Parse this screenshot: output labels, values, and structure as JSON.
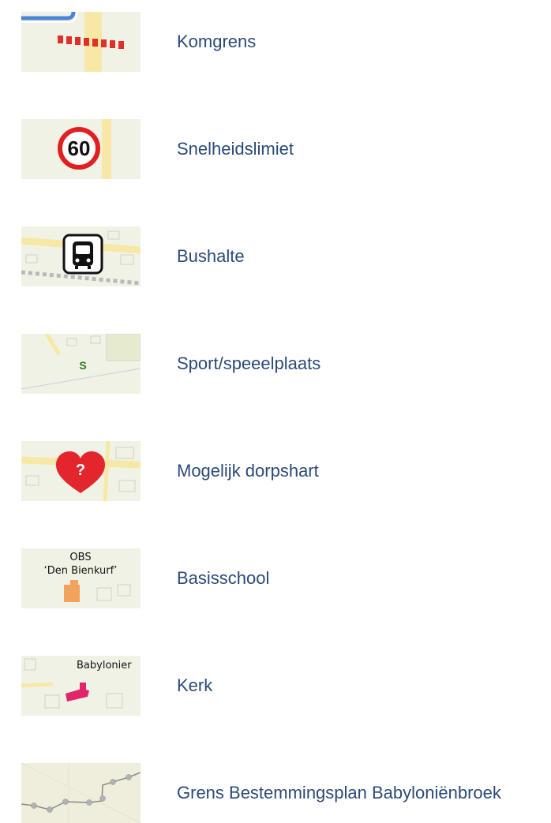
{
  "legend": {
    "items": [
      {
        "icon": "municipal-boundary-icon",
        "label": "Komgrens"
      },
      {
        "icon": "speed-limit-icon",
        "label": "Snelheidslimiet",
        "sign_text": "60"
      },
      {
        "icon": "bus-stop-icon",
        "label": "Bushalte"
      },
      {
        "icon": "sport-playground-icon",
        "label": "Sport/speeelplaats",
        "marker_text": "S"
      },
      {
        "icon": "heart-question-icon",
        "label": "Mogelijk dorpshart",
        "marker_text": "?"
      },
      {
        "icon": "school-icon",
        "label": "Basisschool",
        "map_label_line1": "OBS",
        "map_label_line2": "‘Den Bienkurf’"
      },
      {
        "icon": "church-icon",
        "label": "Kerk",
        "map_label": "Babylonier"
      },
      {
        "icon": "plan-boundary-icon",
        "label": "Grens Bestemmingsplan Babyloniënbroek"
      }
    ]
  }
}
